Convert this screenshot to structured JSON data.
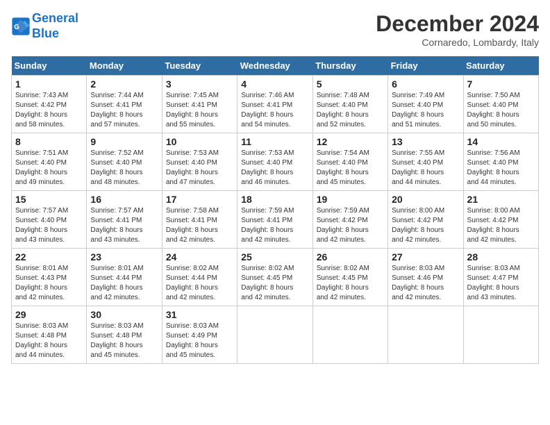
{
  "logo": {
    "line1": "General",
    "line2": "Blue"
  },
  "title": "December 2024",
  "location": "Cornaredo, Lombardy, Italy",
  "weekdays": [
    "Sunday",
    "Monday",
    "Tuesday",
    "Wednesday",
    "Thursday",
    "Friday",
    "Saturday"
  ],
  "weeks": [
    [
      {
        "day": "1",
        "info": "Sunrise: 7:43 AM\nSunset: 4:42 PM\nDaylight: 8 hours\nand 58 minutes."
      },
      {
        "day": "2",
        "info": "Sunrise: 7:44 AM\nSunset: 4:41 PM\nDaylight: 8 hours\nand 57 minutes."
      },
      {
        "day": "3",
        "info": "Sunrise: 7:45 AM\nSunset: 4:41 PM\nDaylight: 8 hours\nand 55 minutes."
      },
      {
        "day": "4",
        "info": "Sunrise: 7:46 AM\nSunset: 4:41 PM\nDaylight: 8 hours\nand 54 minutes."
      },
      {
        "day": "5",
        "info": "Sunrise: 7:48 AM\nSunset: 4:40 PM\nDaylight: 8 hours\nand 52 minutes."
      },
      {
        "day": "6",
        "info": "Sunrise: 7:49 AM\nSunset: 4:40 PM\nDaylight: 8 hours\nand 51 minutes."
      },
      {
        "day": "7",
        "info": "Sunrise: 7:50 AM\nSunset: 4:40 PM\nDaylight: 8 hours\nand 50 minutes."
      }
    ],
    [
      {
        "day": "8",
        "info": "Sunrise: 7:51 AM\nSunset: 4:40 PM\nDaylight: 8 hours\nand 49 minutes."
      },
      {
        "day": "9",
        "info": "Sunrise: 7:52 AM\nSunset: 4:40 PM\nDaylight: 8 hours\nand 48 minutes."
      },
      {
        "day": "10",
        "info": "Sunrise: 7:53 AM\nSunset: 4:40 PM\nDaylight: 8 hours\nand 47 minutes."
      },
      {
        "day": "11",
        "info": "Sunrise: 7:53 AM\nSunset: 4:40 PM\nDaylight: 8 hours\nand 46 minutes."
      },
      {
        "day": "12",
        "info": "Sunrise: 7:54 AM\nSunset: 4:40 PM\nDaylight: 8 hours\nand 45 minutes."
      },
      {
        "day": "13",
        "info": "Sunrise: 7:55 AM\nSunset: 4:40 PM\nDaylight: 8 hours\nand 44 minutes."
      },
      {
        "day": "14",
        "info": "Sunrise: 7:56 AM\nSunset: 4:40 PM\nDaylight: 8 hours\nand 44 minutes."
      }
    ],
    [
      {
        "day": "15",
        "info": "Sunrise: 7:57 AM\nSunset: 4:40 PM\nDaylight: 8 hours\nand 43 minutes."
      },
      {
        "day": "16",
        "info": "Sunrise: 7:57 AM\nSunset: 4:41 PM\nDaylight: 8 hours\nand 43 minutes."
      },
      {
        "day": "17",
        "info": "Sunrise: 7:58 AM\nSunset: 4:41 PM\nDaylight: 8 hours\nand 42 minutes."
      },
      {
        "day": "18",
        "info": "Sunrise: 7:59 AM\nSunset: 4:41 PM\nDaylight: 8 hours\nand 42 minutes."
      },
      {
        "day": "19",
        "info": "Sunrise: 7:59 AM\nSunset: 4:42 PM\nDaylight: 8 hours\nand 42 minutes."
      },
      {
        "day": "20",
        "info": "Sunrise: 8:00 AM\nSunset: 4:42 PM\nDaylight: 8 hours\nand 42 minutes."
      },
      {
        "day": "21",
        "info": "Sunrise: 8:00 AM\nSunset: 4:42 PM\nDaylight: 8 hours\nand 42 minutes."
      }
    ],
    [
      {
        "day": "22",
        "info": "Sunrise: 8:01 AM\nSunset: 4:43 PM\nDaylight: 8 hours\nand 42 minutes."
      },
      {
        "day": "23",
        "info": "Sunrise: 8:01 AM\nSunset: 4:44 PM\nDaylight: 8 hours\nand 42 minutes."
      },
      {
        "day": "24",
        "info": "Sunrise: 8:02 AM\nSunset: 4:44 PM\nDaylight: 8 hours\nand 42 minutes."
      },
      {
        "day": "25",
        "info": "Sunrise: 8:02 AM\nSunset: 4:45 PM\nDaylight: 8 hours\nand 42 minutes."
      },
      {
        "day": "26",
        "info": "Sunrise: 8:02 AM\nSunset: 4:45 PM\nDaylight: 8 hours\nand 42 minutes."
      },
      {
        "day": "27",
        "info": "Sunrise: 8:03 AM\nSunset: 4:46 PM\nDaylight: 8 hours\nand 42 minutes."
      },
      {
        "day": "28",
        "info": "Sunrise: 8:03 AM\nSunset: 4:47 PM\nDaylight: 8 hours\nand 43 minutes."
      }
    ],
    [
      {
        "day": "29",
        "info": "Sunrise: 8:03 AM\nSunset: 4:48 PM\nDaylight: 8 hours\nand 44 minutes."
      },
      {
        "day": "30",
        "info": "Sunrise: 8:03 AM\nSunset: 4:48 PM\nDaylight: 8 hours\nand 45 minutes."
      },
      {
        "day": "31",
        "info": "Sunrise: 8:03 AM\nSunset: 4:49 PM\nDaylight: 8 hours\nand 45 minutes."
      },
      null,
      null,
      null,
      null
    ]
  ]
}
